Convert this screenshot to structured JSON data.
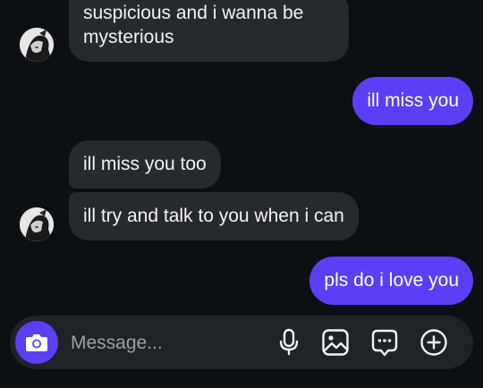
{
  "messages": [
    {
      "direction": "in",
      "text_line1": "suspicious and i wanna be",
      "text_line2": "mysterious"
    },
    {
      "direction": "out",
      "text": "ill miss you"
    },
    {
      "direction": "in",
      "text": "ill miss you too"
    },
    {
      "direction": "in",
      "text": "ill try and talk to you when i can"
    },
    {
      "direction": "out",
      "text": "pls do i love you"
    }
  ],
  "composer": {
    "placeholder": "Message...",
    "icons": [
      "camera-icon",
      "microphone-icon",
      "image-icon",
      "sticker-chat-icon",
      "plus-circle-icon"
    ]
  },
  "colors": {
    "background": "#0c1014",
    "incoming_bubble": "#262a2f",
    "outgoing_bubble": "#5b3ff5",
    "composer": "#1f2328"
  }
}
